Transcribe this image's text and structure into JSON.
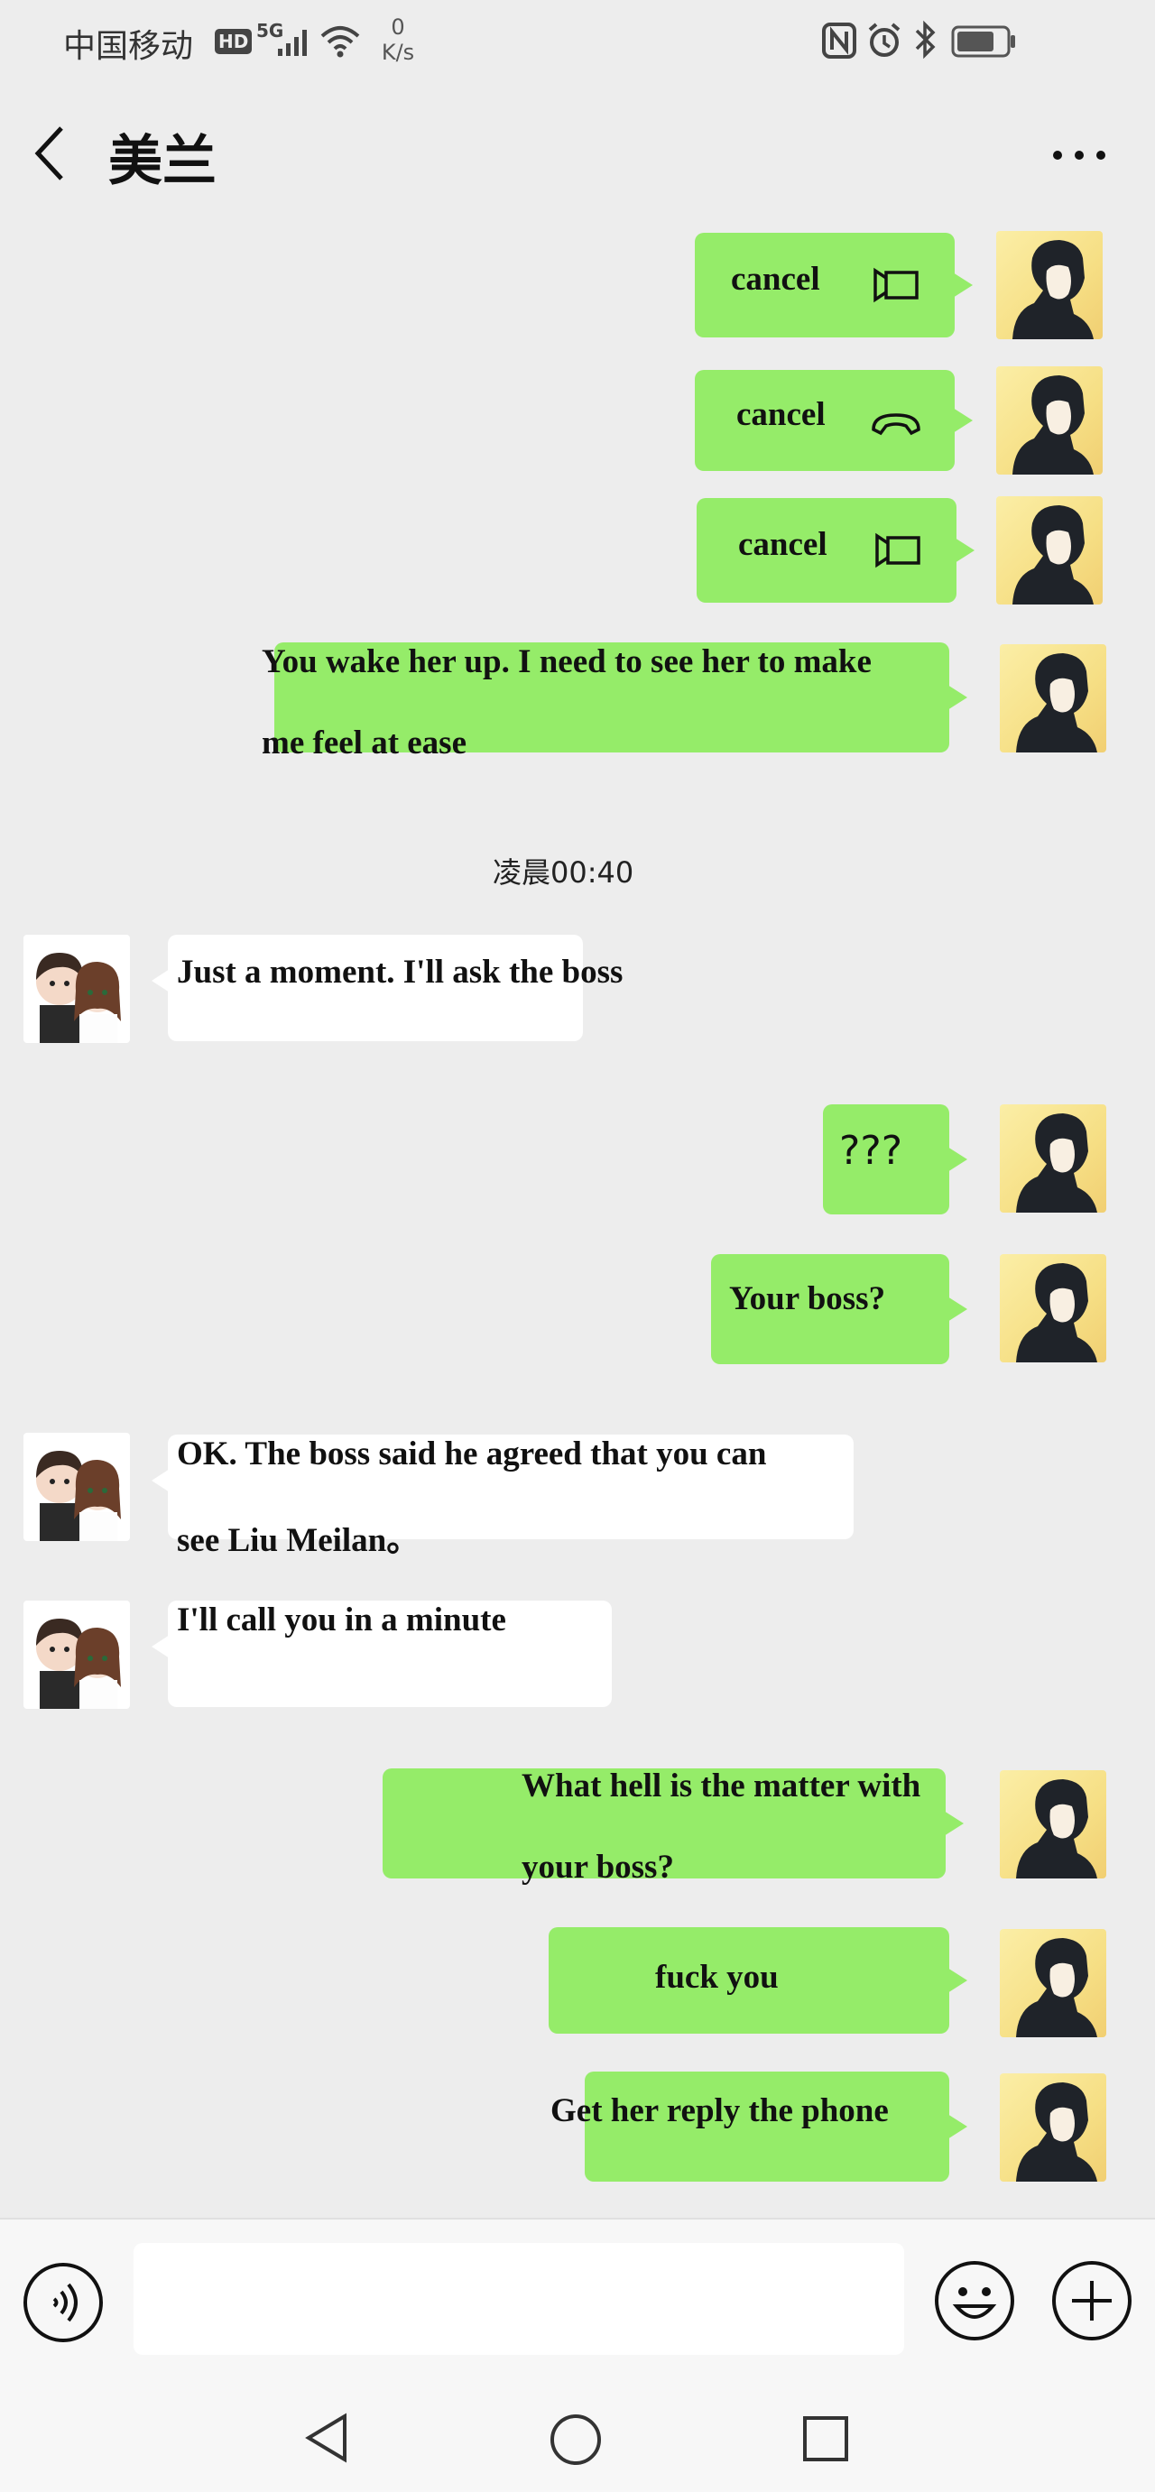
{
  "status_bar": {
    "carrier": "中国移动",
    "hd": "HD",
    "network": "5G",
    "speed_value": "0",
    "speed_unit": "K/s"
  },
  "header": {
    "title": "美兰",
    "back_icon": "chevron-left-icon",
    "more_icon": "more-dots-icon"
  },
  "call_records": [
    {
      "label": "cancel",
      "icon": "video-call-icon"
    },
    {
      "label": "cancel",
      "icon": "phone-hangup-icon"
    },
    {
      "label": "cancel",
      "icon": "video-call-icon"
    }
  ],
  "messages": {
    "m1_line1": "You wake her up. I need to see her to make",
    "m1_line2": "me feel at ease",
    "timestamp": "凌晨00:40",
    "m2": "Just a moment. I'll ask the boss",
    "m3": "???",
    "m4": "Your boss?",
    "m5_line1": "OK. The boss said he agreed that you can",
    "m5_line2": "see Liu Meilan。",
    "m6": "I'll call you in a minute",
    "m7_line1": "What hell is the matter with",
    "m7_line2": "your boss?",
    "m8": "fuck you",
    "m9": "Get her reply the phone"
  },
  "input_bar": {
    "voice_icon": "voice-input-icon",
    "text_value": "",
    "emoji_icon": "emoji-icon",
    "plus_icon": "plus-icon"
  },
  "nav_bar": {
    "back_icon": "nav-back-icon",
    "home_icon": "nav-home-icon",
    "recents_icon": "nav-recents-icon"
  },
  "colors": {
    "background": "#ededed",
    "my_bubble": "#95ec69",
    "their_bubble": "#ffffff"
  }
}
